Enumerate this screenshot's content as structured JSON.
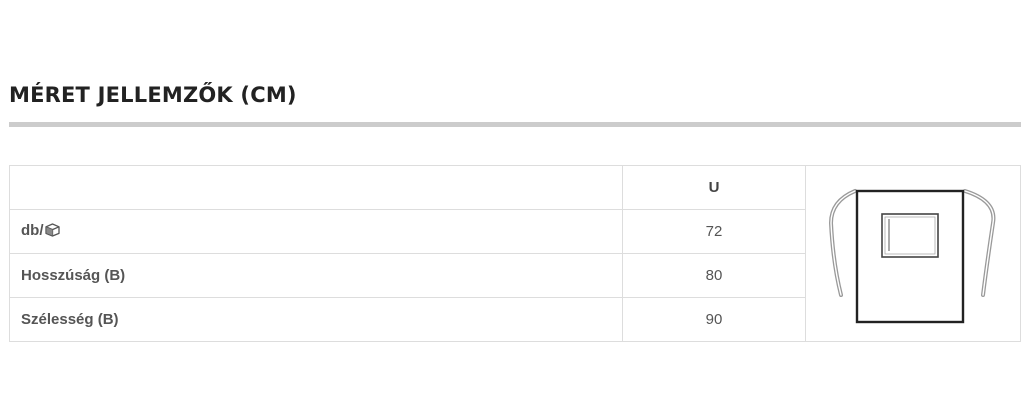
{
  "section": {
    "title": "MÉRET JELLEMZŐK (CM)"
  },
  "table": {
    "header": {
      "label": "",
      "size": "U"
    },
    "rows": [
      {
        "label": "db/",
        "icon": "box-icon",
        "value": "72"
      },
      {
        "label": "Hosszúság (B)",
        "value": "80"
      },
      {
        "label": "Szélesség (B)",
        "value": "90"
      }
    ]
  },
  "image": {
    "icon": "apron-with-pocket-diagram",
    "stroke_color": "#222222",
    "tie_color": "#999999"
  }
}
